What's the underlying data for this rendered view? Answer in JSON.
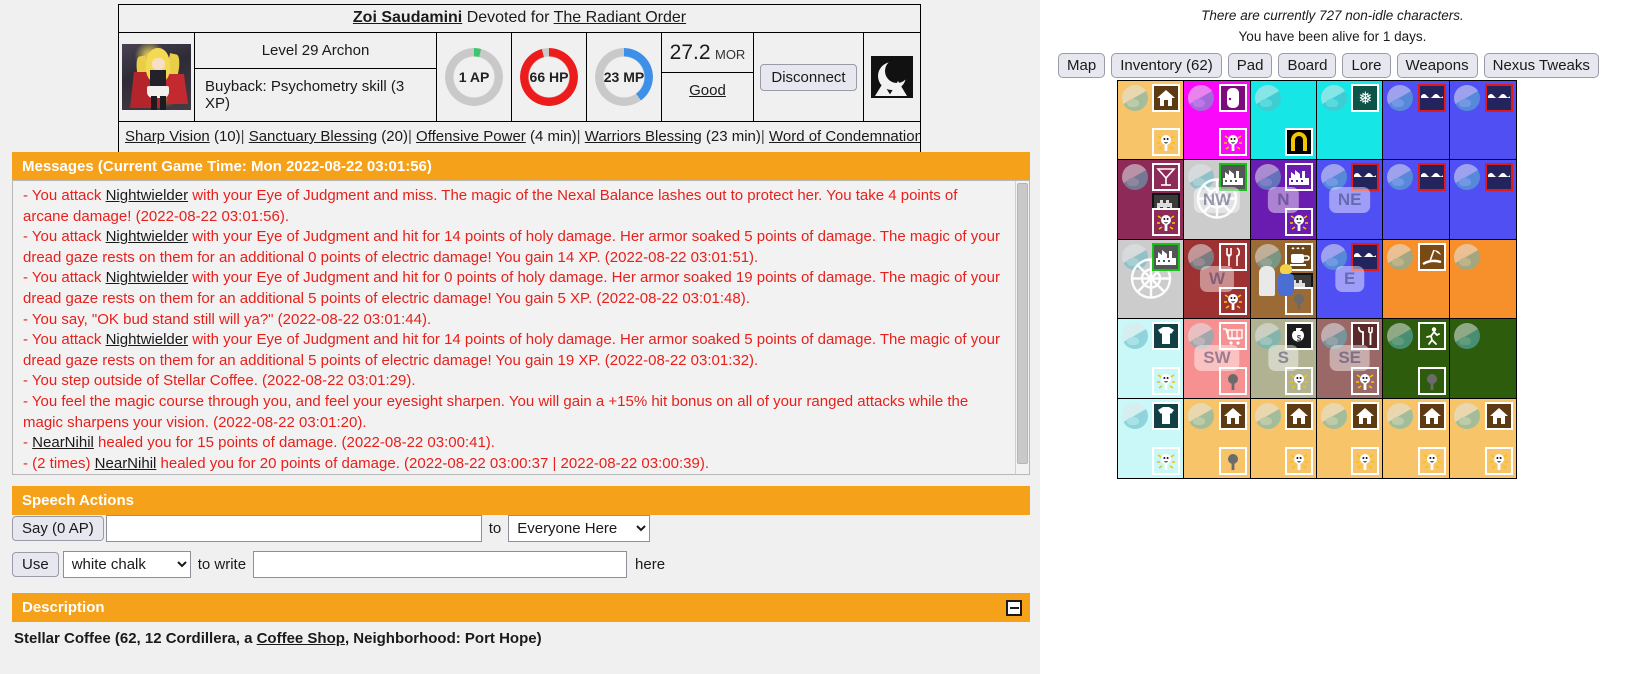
{
  "character": {
    "name": "Zoi Saudamini",
    "devotion_prefix": "Devoted for",
    "faction": "The Radiant Order",
    "level_line": "Level 29 Archon",
    "buyback_line": "Buyback: Psychometry skill (3 XP)",
    "ap": "1 AP",
    "hp": "66 HP",
    "mp": "23 MP",
    "morale_value": "27.2",
    "morale_unit": "MOR",
    "mood": "Good",
    "disconnect_label": "Disconnect",
    "ap_color": "#3ec46d",
    "hp_color": "#ec1c1c",
    "mp_color": "#3d8fe8",
    "ring_bg": "#c9c9c9"
  },
  "buffs": [
    {
      "name": "Sharp Vision",
      "value": "(10)"
    },
    {
      "name": "Sanctuary Blessing",
      "value": "(20)"
    },
    {
      "name": "Offensive Power",
      "value": "(4 min)"
    },
    {
      "name": "Warriors Blessing",
      "value": "(23 min)"
    },
    {
      "name": "Word of Condemnation",
      "value": ""
    }
  ],
  "messages_section": {
    "title": "Messages (Current Game Time: Mon 2022-08-22 03:01:56)",
    "entries": [
      "- You attack Nightwielder with your Eye of Judgment and miss. The magic of the Nexal Balance lashes out to protect her. You take 4 points of arcane damage! (2022-08-22 03:01:56).",
      "- You attack Nightwielder with your Eye of Judgment and hit for 14 points of holy damage. Her armor soaked 5 points of damage. The magic of your dread gaze rests on them for an additional 0 points of electric damage! You gain 14 XP. (2022-08-22 03:01:51).",
      "- You attack Nightwielder with your Eye of Judgment and hit for 0 points of holy damage. Her armor soaked 19 points of damage. The magic of your dread gaze rests on them for an additional 5 points of electric damage! You gain 5 XP. (2022-08-22 03:01:48).",
      "- You say, \"OK bud stand still will ya?\" (2022-08-22 03:01:44).",
      "- You attack Nightwielder with your Eye of Judgment and hit for 14 points of holy damage. Her armor soaked 5 points of damage. The magic of your dread gaze rests on them for an additional 5 points of electric damage! You gain 19 XP. (2022-08-22 03:01:32).",
      "- You step outside of Stellar Coffee. (2022-08-22 03:01:29).",
      "- You feel the magic course through you, and feel your eyesight sharpen. You will gain a +15% hit bonus on all of your ranged attacks while the magic sharpens your vision. (2022-08-22 03:01:20).",
      "- NearNihil healed you for 15 points of damage. (2022-08-22 03:00:41).",
      "- (2 times) NearNihil healed you for 20 points of damage. (2022-08-22 03:00:37 | 2022-08-22 03:00:39)."
    ]
  },
  "speech_section": {
    "title": "Speech Actions",
    "say_button": "Say (0 AP)",
    "say_value": "",
    "to_label": "to",
    "say_target_selected": "Everyone Here",
    "say_target_options": [
      "Everyone Here"
    ],
    "use_button": "Use",
    "chalk_selected": "white chalk",
    "chalk_options": [
      "white chalk"
    ],
    "to_write_label": "to write",
    "write_value": "",
    "here_label": "here"
  },
  "description_section": {
    "title": "Description",
    "collapse_icon": "minus",
    "text_before": "Stellar Coffee (62, 12 Cordillera, a ",
    "link": "Coffee Shop",
    "text_after": ", Neighborhood: Port Hope)"
  },
  "right_panel": {
    "info_line1": "There are currently 727 non-idle characters.",
    "info_line2": "You have been alive for 1 days.",
    "buttons": [
      "Map",
      "Inventory (62)",
      "Pad",
      "Board",
      "Lore",
      "Weapons",
      "Nexus Tweaks"
    ],
    "accent_color": "#f5a11a"
  },
  "map": {
    "rows": 5,
    "cols": 6,
    "cells": [
      {
        "bg": "#f7c46a",
        "tr": "house",
        "br": "streetlight-on",
        "dir": "",
        "here": false
      },
      {
        "bg": "#f908f9",
        "tr": "door",
        "br": "streetlight-on",
        "dir": "",
        "here": false
      },
      {
        "bg": "#17e6e6",
        "tr": "",
        "br": "monument",
        "dir": "",
        "here": false
      },
      {
        "bg": "#17e6e6",
        "tr": "park",
        "br": "",
        "dir": "",
        "here": false
      },
      {
        "bg": "#4f4ff4",
        "tr": "water",
        "br": "",
        "dir": "",
        "here": false
      },
      {
        "bg": "#4f4ff4",
        "tr": "water",
        "br": "",
        "dir": "",
        "here": false
      },
      {
        "bg": "#8e2a57",
        "tr": "drink",
        "mid": "tower",
        "br": "streetlight-on",
        "dir": "",
        "here": false
      },
      {
        "bg": "#cccccc",
        "tr": "factory-green",
        "br": "",
        "dir": "NW",
        "here": false,
        "web": true
      },
      {
        "bg": "#6a1bb0",
        "tr": "factory",
        "br": "streetlight-on",
        "dir": "N",
        "here": false
      },
      {
        "bg": "#4f4ff4",
        "tr": "water",
        "br": "",
        "dir": "NE",
        "here": false
      },
      {
        "bg": "#4f4ff4",
        "tr": "water",
        "br": "",
        "dir": "",
        "here": false
      },
      {
        "bg": "#4f4ff4",
        "tr": "water",
        "br": "",
        "dir": "",
        "here": false
      },
      {
        "bg": "#cccccc",
        "tr": "factory-green",
        "br": "",
        "dir": "",
        "here": false,
        "web": true
      },
      {
        "bg": "#9e3232",
        "tr": "restaurant",
        "br": "streetlight-on",
        "dir": "W",
        "here": false
      },
      {
        "bg": "#9b6a35",
        "tr": "cafe",
        "mid": "tower",
        "br": "streetlight-off",
        "dir": "",
        "here": true
      },
      {
        "bg": "#4f4ff4",
        "tr": "water",
        "br": "",
        "dir": "E",
        "here": false
      },
      {
        "bg": "#f7902a",
        "tr": "beach",
        "br": "",
        "dir": "",
        "here": false
      },
      {
        "bg": "#f7902a",
        "tr": "",
        "br": "",
        "dir": "",
        "here": false
      },
      {
        "bg": "#caf7f7",
        "tr": "clothing",
        "br": "streetlight-on",
        "dir": "",
        "here": false
      },
      {
        "bg": "#f79191",
        "tr": "shopping-cart",
        "br": "streetlight-off",
        "dir": "SW",
        "here": false
      },
      {
        "bg": "#b1b292",
        "tr": "bank",
        "br": "streetlight-on",
        "dir": "S",
        "here": false
      },
      {
        "bg": "#9b6868",
        "tr": "tools",
        "br": "streetlight-on",
        "dir": "SE",
        "here": false
      },
      {
        "bg": "#2d5c0c",
        "tr": "gym",
        "br": "streetlight-off",
        "dir": "",
        "here": false
      },
      {
        "bg": "#2d5c0c",
        "tr": "",
        "br": "",
        "dir": "",
        "here": false
      },
      {
        "bg": "#caf7f7",
        "tr": "clothing",
        "br": "streetlight-on",
        "dir": "",
        "here": false
      },
      {
        "bg": "#f7c46a",
        "tr": "house",
        "br": "streetlight-off",
        "dir": "",
        "here": false
      },
      {
        "bg": "#f7c46a",
        "tr": "house",
        "br": "streetlight-on",
        "dir": "",
        "here": false
      },
      {
        "bg": "#f7c46a",
        "tr": "house",
        "br": "streetlight-on",
        "dir": "",
        "here": false
      },
      {
        "bg": "#f7c46a",
        "tr": "house",
        "br": "streetlight-on",
        "dir": "",
        "here": false
      },
      {
        "bg": "#f7c46a",
        "tr": "house",
        "br": "streetlight-on",
        "dir": "",
        "here": false
      }
    ]
  }
}
